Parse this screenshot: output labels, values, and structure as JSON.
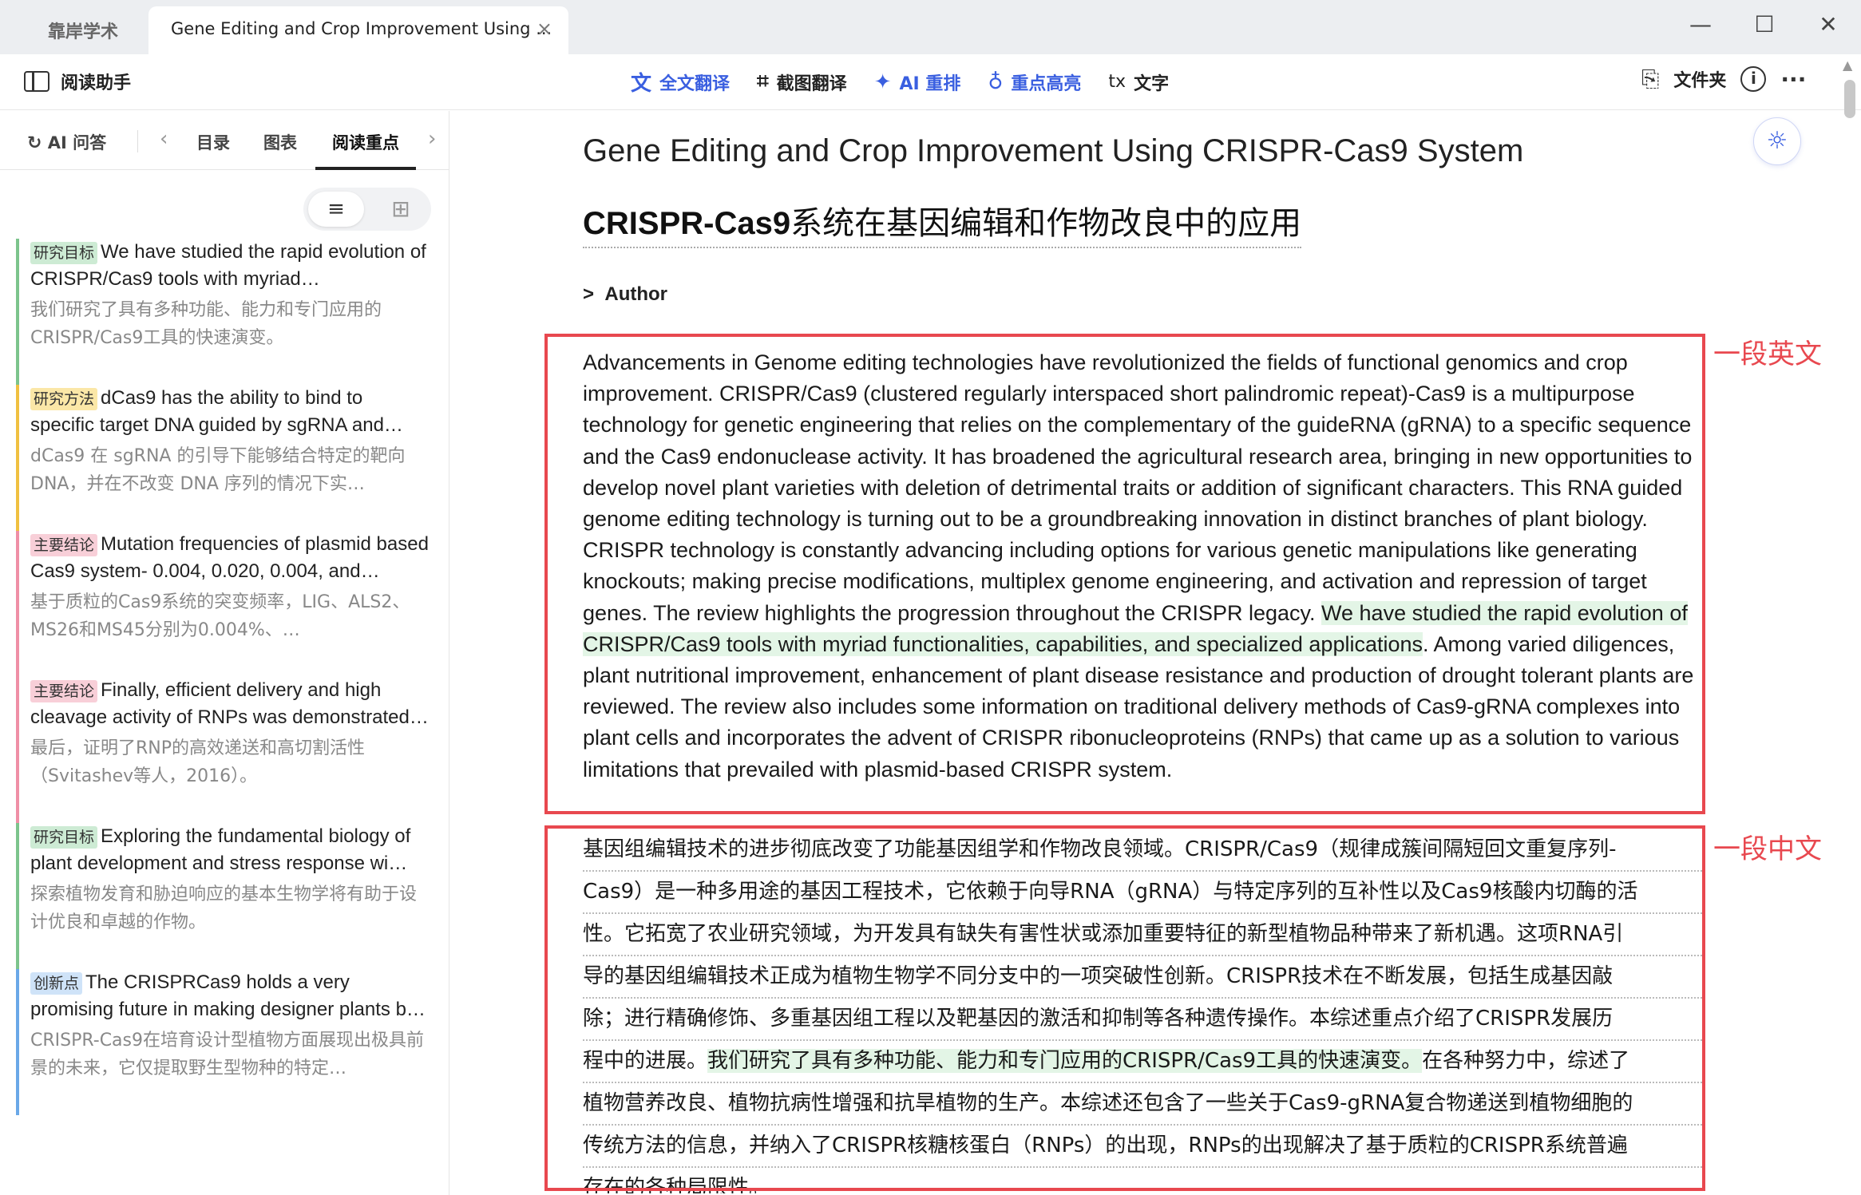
{
  "tabs": {
    "home": "靠岸学术",
    "active_title": "Gene Editing and Crop Improvement Using ...",
    "close": "×"
  },
  "window": {
    "minimize": "—",
    "maximize": "☐",
    "close": "✕"
  },
  "toolbar": {
    "reading_assistant": "阅读助手",
    "full_translate": "全文翻译",
    "screenshot_translate": "截图翻译",
    "ai_relayout": "AI 重排",
    "highlight": "重点高亮",
    "text_icon": "tx",
    "text": "文字",
    "folder": "文件夹",
    "info": "i",
    "more": "···"
  },
  "sidebar": {
    "tabs": [
      {
        "label": "AI 问答"
      },
      {
        "label": "目录"
      },
      {
        "label": "图表"
      },
      {
        "label": "阅读重点"
      }
    ],
    "cards": [
      {
        "tag": "研究目标",
        "en": "We have studied the rapid evolution of CRISPR/Cas9 tools with myriad…",
        "zh": "我们研究了具有多种功能、能力和专门应用的CRISPR/Cas9工具的快速演变。"
      },
      {
        "tag": "研究方法",
        "en": "dCas9 has the ability to bind to specific target DNA guided by sgRNA and…",
        "zh": "dCas9 在 sgRNA 的引导下能够结合特定的靶向 DNA，并在不改变 DNA 序列的情况下实…"
      },
      {
        "tag": "主要结论",
        "en": "Mutation frequencies of plasmid based Cas9 system- 0.004, 0.020, 0.004, and…",
        "zh": "基于质粒的Cas9系统的突变频率，LIG、ALS2、MS26和MS45分别为0.004%、…"
      },
      {
        "tag": "主要结论",
        "en": "Finally, efficient delivery and high cleavage activity of RNPs was demonstrated…",
        "zh": "最后，证明了RNP的高效递送和高切割活性（Svitashev等人，2016）。"
      },
      {
        "tag": "研究目标",
        "en": "Exploring the fundamental biology of plant development and stress response wi…",
        "zh": "探索植物发育和胁迫响应的基本生物学将有助于设计优良和卓越的作物。"
      },
      {
        "tag": "创新点",
        "en": "The CRISPRCas9 holds a very promising future in making designer plants b…",
        "zh": "CRISPR-Cas9在培育设计型植物方面展现出极具前景的未来，它仅提取野生型物种的特定…"
      }
    ]
  },
  "main": {
    "title_en": "Gene Editing and Crop Improvement Using CRISPR-Cas9 System",
    "title_zh_bold": "CRISPR-Cas9",
    "title_zh_rest": "系统在基因编辑和作物改良中的应用",
    "author": "Author",
    "author_caret": ">",
    "para_en_before": "Advancements in Genome editing technologies have revolutionized the fields of functional genomics and crop improvement. CRISPR/Cas9 (clustered regularly interspaced short palindromic repeat)-Cas9 is a multipurpose technology for genetic engineering that relies on the complementary of the guideRNA (gRNA) to a specific sequence and the Cas9 endonuclease activity. It has broadened the agricultural research area, bringing in new opportunities to develop novel plant varieties with deletion of detrimental traits or addition of significant characters. This RNA guided genome editing technology is turning out to be a groundbreaking innovation in distinct branches of plant biology. CRISPR technology is constantly advancing including options for various genetic manipulations like generating knockouts; making precise modifications, multiplex genome engineering, and activation and repression of target genes. The review highlights the progression throughout the CRISPR legacy. ",
    "para_en_highlight": "We have studied the rapid evolution of CRISPR/Cas9 tools with myriad functionalities, capabilities, and specialized applications",
    "para_en_after": ". Among varied diligences, plant nutritional improvement, enhancement of plant disease resistance and production of drought tolerant plants are reviewed. The review also includes some information on traditional delivery methods of Cas9-gRNA complexes into plant cells and incorporates the advent of CRISPR ribonucleoproteins (RNPs) that came up as a solution to various limitations that prevailed with plasmid-based CRISPR system.",
    "para_zh_lines": [
      "基因组编辑技术的进步彻底改变了功能基因组学和作物改良领域。CRISPR/Cas9（规律成簇间隔短回文重复序列-",
      "Cas9）是一种多用途的基因工程技术，它依赖于向导RNA（gRNA）与特定序列的互补性以及Cas9核酸内切酶的活",
      "性。它拓宽了农业研究领域，为开发具有缺失有害性状或添加重要特征的新型植物品种带来了新机遇。这项RNA引",
      "导的基因组编辑技术正成为植物生物学不同分支中的一项突破性创新。CRISPR技术在不断发展，包括生成基因敲",
      "除；进行精确修饰、多重基因组工程以及靶基因的激活和抑制等各种遗传操作。本综述重点介绍了CRISPR发展历"
    ],
    "para_zh_line6_before": "程中的进展。",
    "para_zh_line6_highlight": "我们研究了具有多种功能、能力和专门应用的CRISPR/Cas9工具的快速演变。",
    "para_zh_line6_after": "在各种努力中，综述了",
    "para_zh_lines_rest": [
      "植物营养改良、植物抗病性增强和抗旱植物的生产。本综述还包含了一些关于Cas9-gRNA复合物递送到植物细胞的",
      "传统方法的信息，并纳入了CRISPR核糖核蛋白（RNPs）的出现，RNPs的出现解决了基于质粒的CRISPR系统普遍",
      "存在的各种局限性。"
    ]
  },
  "annotations": {
    "english_label": "一段英文",
    "chinese_label": "一段中文"
  },
  "colors": {
    "accent_blue": "#3a5fe0",
    "annotation_red": "#e8484f",
    "highlight_green": "#e3f5e6"
  }
}
